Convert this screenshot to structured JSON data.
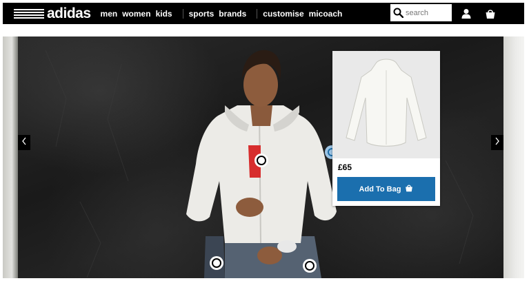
{
  "header": {
    "logo_text": "adidas",
    "nav_primary": [
      "men",
      "women",
      "kids"
    ],
    "nav_secondary": [
      "sports",
      "brands"
    ],
    "nav_tertiary": [
      "customise",
      "micoach"
    ],
    "search_placeholder": "search",
    "account_icon": "user-icon",
    "bag_icon": "shopping-bag-icon"
  },
  "hero": {
    "prev_icon": "chevron-left-icon",
    "next_icon": "chevron-right-icon"
  },
  "product_popup": {
    "price": "£65",
    "button_label": "Add To Bag",
    "button_icon": "shopping-bag-icon"
  },
  "colors": {
    "nav_bg": "#000000",
    "accent": "#1b6fae"
  }
}
